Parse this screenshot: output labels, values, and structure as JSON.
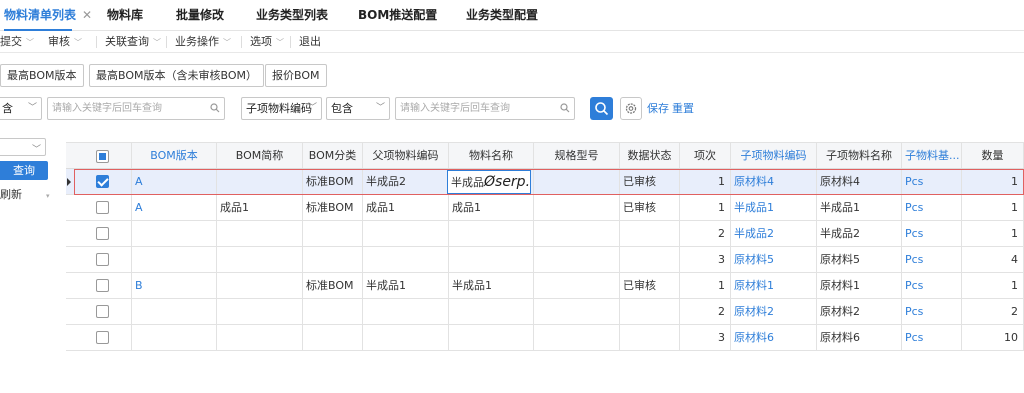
{
  "tabs": [
    {
      "label": "物料清单列表",
      "active": true
    },
    {
      "label": "物料库"
    },
    {
      "label": "批量修改"
    },
    {
      "label": "业务类型列表"
    },
    {
      "label": "BOM推送配置"
    },
    {
      "label": "业务类型配置"
    }
  ],
  "tab_close_glyph": "✕",
  "menu": {
    "submit": "提交",
    "audit": "审核",
    "related_query": "关联查询",
    "business_ops": "业务操作",
    "options": "选项",
    "exit": "退出"
  },
  "version_buttons": [
    "最高BOM版本",
    "最高BOM版本（含未审核BOM）",
    "报价BOM"
  ],
  "filter": {
    "op1": "含",
    "placeholder1": "请输入关键字后回车查询",
    "field2": "子项物料编码",
    "op2": "包含",
    "placeholder2": "请输入关键字后回车查询",
    "save": "保存",
    "reset": "重置"
  },
  "left_panel": {
    "query": "查询",
    "refresh": "刷新"
  },
  "grid": {
    "columns": [
      "BOM版本",
      "BOM简称",
      "BOM分类",
      "父项物料编码",
      "物料名称",
      "规格型号",
      "数据状态",
      "项次",
      "子项物料编码",
      "子项物料名称",
      "子物料基...",
      "数量"
    ],
    "blue_columns": [
      "BOM版本",
      "子项物料编码",
      "子物料基..."
    ],
    "rows": [
      {
        "checked": true,
        "bom_version": "A",
        "bom_short": "",
        "bom_class": "标准BOM",
        "parent_code": "半成品2",
        "material_name": "半成品",
        "spec": "",
        "status": "已审核",
        "item_no": "1",
        "child_code": "原材料4",
        "child_name": "原材料4",
        "child_unit": "Pcs",
        "qty": "1"
      },
      {
        "checked": false,
        "bom_version": "A",
        "bom_short": "成品1",
        "bom_class": "标准BOM",
        "parent_code": "成品1",
        "material_name": "成品1",
        "spec": "",
        "status": "已审核",
        "item_no": "1",
        "child_code": "半成品1",
        "child_name": "半成品1",
        "child_unit": "Pcs",
        "qty": "1"
      },
      {
        "checked": false,
        "bom_version": "",
        "bom_short": "",
        "bom_class": "",
        "parent_code": "",
        "material_name": "",
        "spec": "",
        "status": "",
        "item_no": "2",
        "child_code": "半成品2",
        "child_name": "半成品2",
        "child_unit": "Pcs",
        "qty": "1"
      },
      {
        "checked": false,
        "bom_version": "",
        "bom_short": "",
        "bom_class": "",
        "parent_code": "",
        "material_name": "",
        "spec": "",
        "status": "",
        "item_no": "3",
        "child_code": "原材料5",
        "child_name": "原材料5",
        "child_unit": "Pcs",
        "qty": "4"
      },
      {
        "checked": false,
        "bom_version": "B",
        "bom_short": "",
        "bom_class": "标准BOM",
        "parent_code": "半成品1",
        "material_name": "半成品1",
        "spec": "",
        "status": "已审核",
        "item_no": "1",
        "child_code": "原材料1",
        "child_name": "原材料1",
        "child_unit": "Pcs",
        "qty": "1"
      },
      {
        "checked": false,
        "bom_version": "",
        "bom_short": "",
        "bom_class": "",
        "parent_code": "",
        "material_name": "",
        "spec": "",
        "status": "",
        "item_no": "2",
        "child_code": "原材料2",
        "child_name": "原材料2",
        "child_unit": "Pcs",
        "qty": "2"
      },
      {
        "checked": false,
        "bom_version": "",
        "bom_short": "",
        "bom_class": "",
        "parent_code": "",
        "material_name": "",
        "spec": "",
        "status": "",
        "item_no": "3",
        "child_code": "原材料6",
        "child_name": "原材料6",
        "child_unit": "Pcs",
        "qty": "10"
      }
    ],
    "edit_cell_watermark": "Øserp.net"
  },
  "colors": {
    "accent": "#2e7ed9",
    "selected_row": "#e8eefb",
    "highlight_border": "#e06060"
  }
}
